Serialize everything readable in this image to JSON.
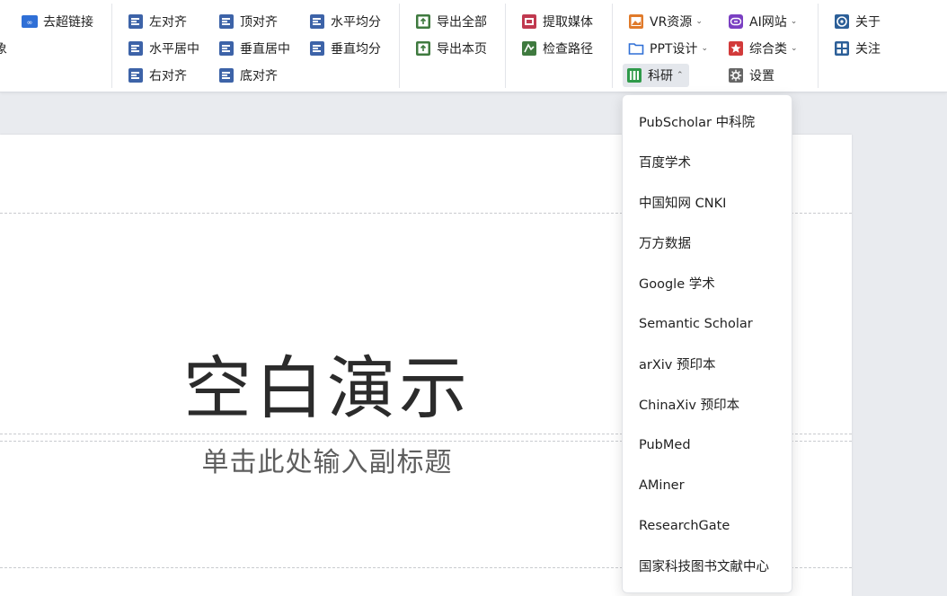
{
  "ribbon": {
    "partial_left_label": "象",
    "remove_hyperlink": "去超链接",
    "align_left": "左对齐",
    "align_center_h": "水平居中",
    "align_right": "右对齐",
    "align_top": "顶对齐",
    "align_middle_v": "垂直居中",
    "align_bottom": "底对齐",
    "distribute_h": "水平均分",
    "distribute_v": "垂直均分",
    "export_all": "导出全部",
    "export_page": "导出本页",
    "extract_media": "提取媒体",
    "check_path": "检查路径",
    "vr_resources": "VR资源",
    "ppt_design": "PPT设计",
    "research": "科研",
    "ai_sites": "AI网站",
    "general": "综合类",
    "settings": "设置",
    "about": "关于",
    "follow": "关注"
  },
  "slide": {
    "title": "空白演示",
    "subtitle": "单击此处输入副标题"
  },
  "research_menu": {
    "items": [
      "PubScholar 中科院",
      "百度学术",
      "中国知网 CNKI",
      "万方数据",
      "Google 学术",
      "Semantic Scholar",
      "arXiv 预印本",
      "ChinaXiv 预印本",
      "PubMed",
      "AMiner",
      "ResearchGate",
      "国家科技图书文献中心"
    ]
  },
  "colors": {
    "align_icon": "#3d63a8",
    "export_icon": "#3f7a3f",
    "media_icon": "#c0394f",
    "vr_icon": "#e07a2a",
    "ppt_icon": "#2f6fd6",
    "research_icon": "#2f9a4a",
    "ai_icon": "#7a3fc2",
    "general_icon": "#d23a3a",
    "settings_icon": "#666666",
    "about_icon": "#2c5f98"
  }
}
